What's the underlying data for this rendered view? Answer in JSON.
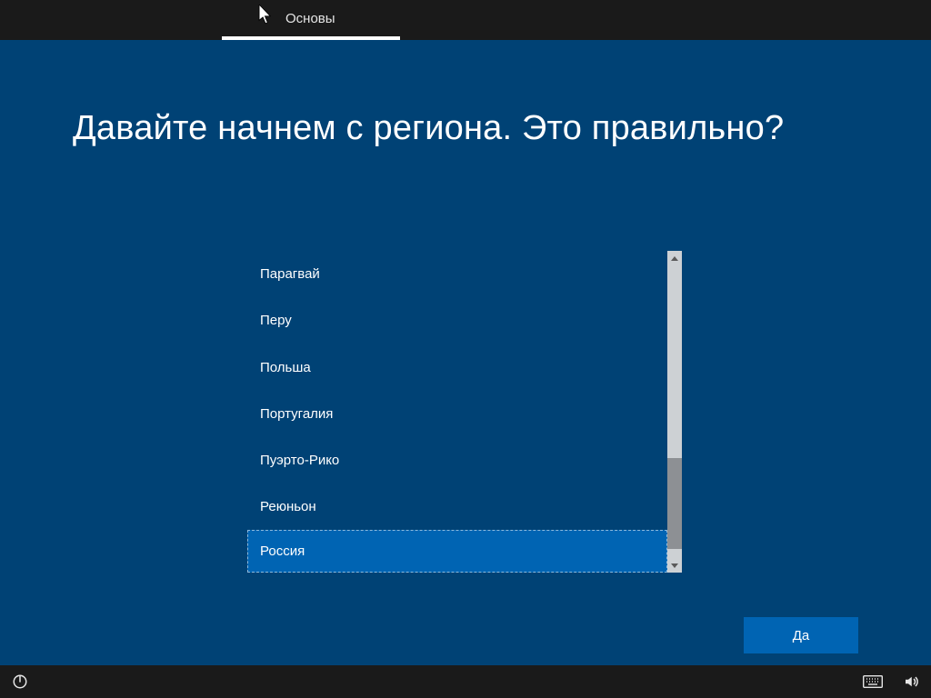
{
  "header": {
    "tab_label": "Основы"
  },
  "page": {
    "title": "Давайте начнем с региона. Это правильно?"
  },
  "regions": {
    "items": [
      {
        "label": "Парагвай"
      },
      {
        "label": "Перу"
      },
      {
        "label": "Польша"
      },
      {
        "label": "Португалия"
      },
      {
        "label": "Пуэрто-Рико"
      },
      {
        "label": "Реюньон"
      },
      {
        "label": "Россия"
      }
    ],
    "selected_index": 6
  },
  "actions": {
    "yes_label": "Да"
  }
}
